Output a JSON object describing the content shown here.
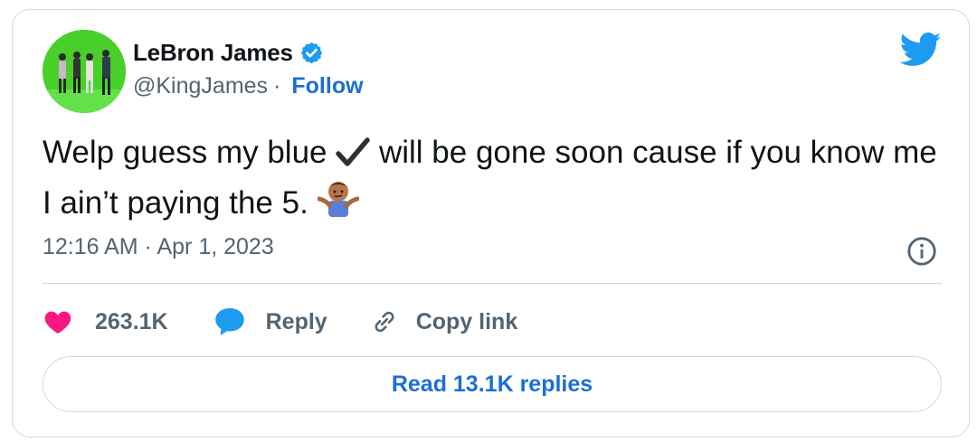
{
  "author": {
    "name": "LeBron James",
    "handle": "@KingJames",
    "separator": "·",
    "follow_label": "Follow",
    "verified": true
  },
  "tweet": {
    "text_part1": "Welp guess my blue",
    "text_part2": "will be gone soon cause if you know me I ain’t paying the 5.",
    "checkmark_glyph": "✔",
    "emoji": "🤷🏽‍♂️",
    "timestamp": "12:16 AM · Apr 1, 2023"
  },
  "actions": {
    "likes": "263.1K",
    "reply_label": "Reply",
    "copy_link_label": "Copy link"
  },
  "read_replies_label": "Read 13.1K replies",
  "icons": {
    "like": "heart-icon",
    "reply": "speech-bubble-icon",
    "copy": "link-icon",
    "info": "info-icon",
    "logo": "twitter-bird-icon",
    "verified": "verified-badge-icon"
  },
  "colors": {
    "accent": "#1d9bf0",
    "link": "#1d6fd1",
    "heart": "#f91880",
    "muted": "#536471",
    "border": "#cfd9de",
    "avatar_bg": "#4fd12c"
  }
}
